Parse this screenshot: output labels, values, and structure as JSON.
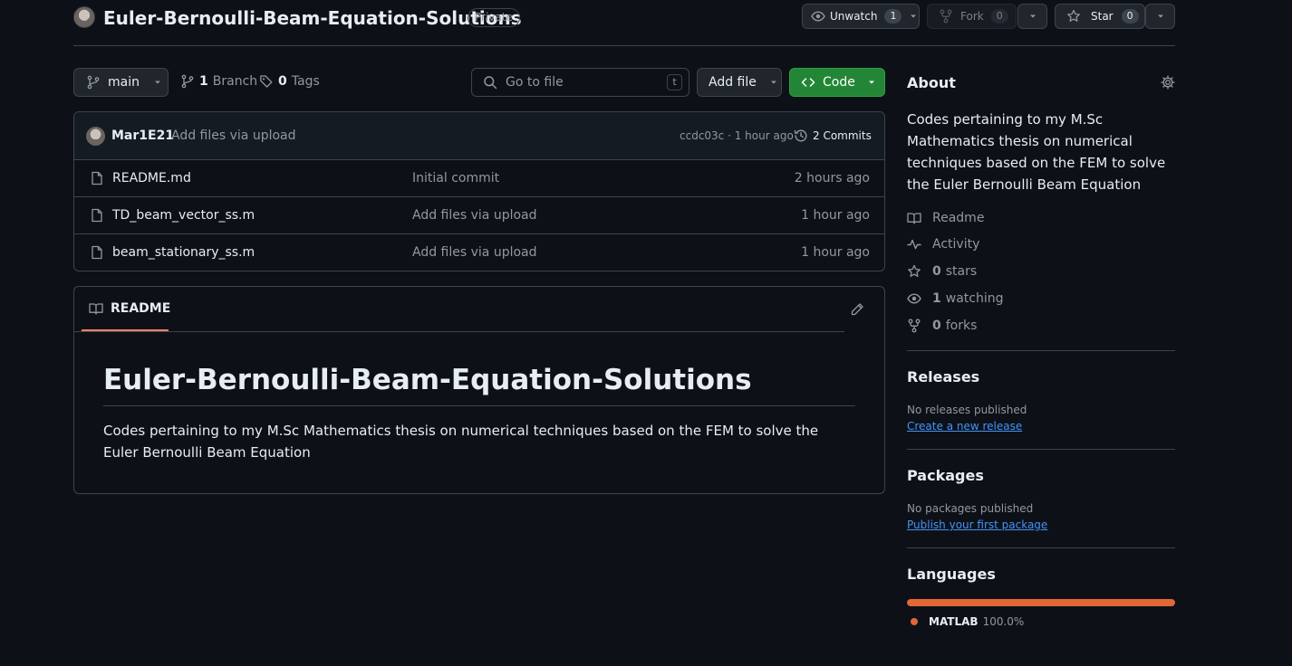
{
  "repo": {
    "name": "Euler-Bernoulli-Beam-Equation-Solutions",
    "visibility": "Private"
  },
  "actions": {
    "unwatch_label": "Unwatch",
    "watch_count": "1",
    "fork_label": "Fork",
    "fork_count": "0",
    "star_label": "Star",
    "star_count": "0"
  },
  "toolbar": {
    "branch": "main",
    "branch_count": "1",
    "branch_label": "Branch",
    "tag_count": "0",
    "tag_label": "Tags",
    "goto_placeholder": "Go to file",
    "goto_key": "t",
    "add_file_label": "Add file",
    "code_label": "Code"
  },
  "commit": {
    "author": "Mar1E21",
    "message": "Add files via upload",
    "meta": "ccdc03c · 1 hour ago",
    "commits_label": "2 Commits"
  },
  "files": [
    {
      "name": "README.md",
      "message": "Initial commit",
      "time": "2 hours ago"
    },
    {
      "name": "TD_beam_vector_ss.m",
      "message": "Add files via upload",
      "time": "1 hour ago"
    },
    {
      "name": "beam_stationary_ss.m",
      "message": "Add files via upload",
      "time": "1 hour ago"
    }
  ],
  "readme": {
    "tab_label": "README",
    "heading": "Euler-Bernoulli-Beam-Equation-Solutions",
    "body": "Codes pertaining to my M.Sc Mathematics thesis on numerical techniques based on the FEM to solve the Euler Bernoulli Beam Equation"
  },
  "about": {
    "title": "About",
    "description": "Codes pertaining to my M.Sc Mathematics thesis on numerical techniques based on the FEM to solve the Euler Bernoulli Beam Equation",
    "readme_label": "Readme",
    "activity_label": "Activity",
    "stars_count": "0",
    "stars_label": "stars",
    "watching_count": "1",
    "watching_label": "watching",
    "forks_count": "0",
    "forks_label": "forks"
  },
  "releases": {
    "title": "Releases",
    "empty": "No releases published",
    "link": "Create a new release"
  },
  "packages": {
    "title": "Packages",
    "empty": "No packages published",
    "link": "Publish your first package"
  },
  "languages": {
    "title": "Languages",
    "items": [
      {
        "name": "MATLAB",
        "percent": "100.0%",
        "share": 100,
        "color": "#e16737"
      }
    ]
  }
}
